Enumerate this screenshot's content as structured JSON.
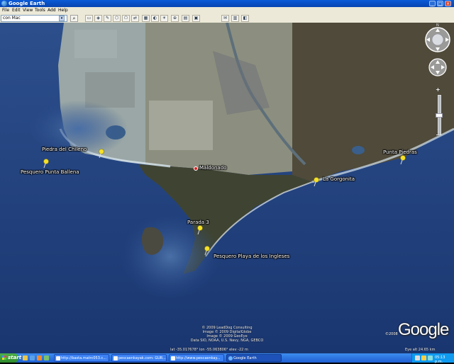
{
  "window": {
    "title": "Google Earth",
    "minimize": "_",
    "maximize": "□",
    "close": "×"
  },
  "menu": [
    "File",
    "Edit",
    "View",
    "Tools",
    "Add",
    "Help"
  ],
  "search": {
    "value": "con Mac",
    "dropdown_glyph": "▾",
    "button_glyph": "⌕"
  },
  "toolbar_glyphs": [
    "▭",
    "◈",
    "✎",
    "⬡",
    "⬠",
    "⇄",
    "▦",
    "◐",
    "☀",
    "⊕",
    "▤",
    "▣",
    "✉",
    "▥",
    "◧"
  ],
  "map": {
    "place_label": "Maldonado",
    "pins": [
      {
        "label": "Piedra del Chileno"
      },
      {
        "label": "Pesquero Punta Ballena"
      },
      {
        "label": "Parada 3"
      },
      {
        "label": "Pesquero Playa de los Ingleses"
      },
      {
        "label": "La Gorgonita"
      },
      {
        "label": "Punta Piedras"
      }
    ],
    "nav_north": "N",
    "zoom_plus": "+",
    "zoom_minus": "−"
  },
  "attribution": [
    "© 2009 LeadDog Consulting",
    "Image © 2009 DigitalGlobe",
    "Image © 2009 GeoEye",
    "Data SIO, NOAA, U.S. Navy, NGA, GEBCO"
  ],
  "status": {
    "coordinates": "lat -35.017678°  lon -55.063806°  elev -22 m",
    "eye_alt": "Eye alt   24.65 km",
    "copyright_year": "©2008",
    "logo": "Google"
  },
  "taskbar": {
    "start": "start",
    "tasks": [
      {
        "label": "http://basta.matrc053.c..."
      },
      {
        "label": "pescaenkayak.com: GUR..."
      },
      {
        "label": "http://www.pescaenkay..."
      },
      {
        "label": "Google Earth"
      }
    ],
    "clock": "05:13 p.m."
  }
}
